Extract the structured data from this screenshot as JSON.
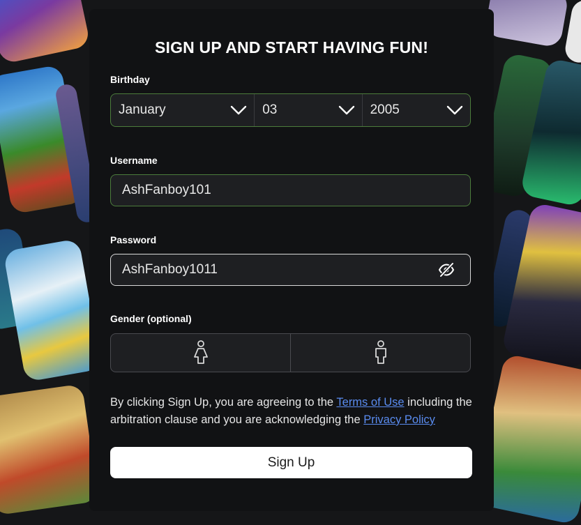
{
  "heading": "SIGN UP AND START HAVING FUN!",
  "birthday": {
    "label": "Birthday",
    "month": "January",
    "day": "03",
    "year": "2005"
  },
  "username": {
    "label": "Username",
    "value": "AshFanboy101"
  },
  "password": {
    "label": "Password",
    "value": "AshFanboy1011",
    "visibility_icon": "eye-off-icon"
  },
  "gender": {
    "label": "Gender (optional)",
    "options": [
      "female-icon",
      "male-icon"
    ]
  },
  "legal": {
    "text_before": "By clicking Sign Up, you are agreeing to the ",
    "terms_link": "Terms of Use",
    "text_middle": " including the arbitration clause and you are acknowledging the ",
    "privacy_link": "Privacy Policy"
  },
  "signup_button": "Sign Up",
  "colors": {
    "page_background": "#151618",
    "card_background": "#111214",
    "field_background": "#1e1f22",
    "valid_border": "#4c7d3c",
    "link": "#5a8cf0",
    "button_background": "#ffffff"
  }
}
